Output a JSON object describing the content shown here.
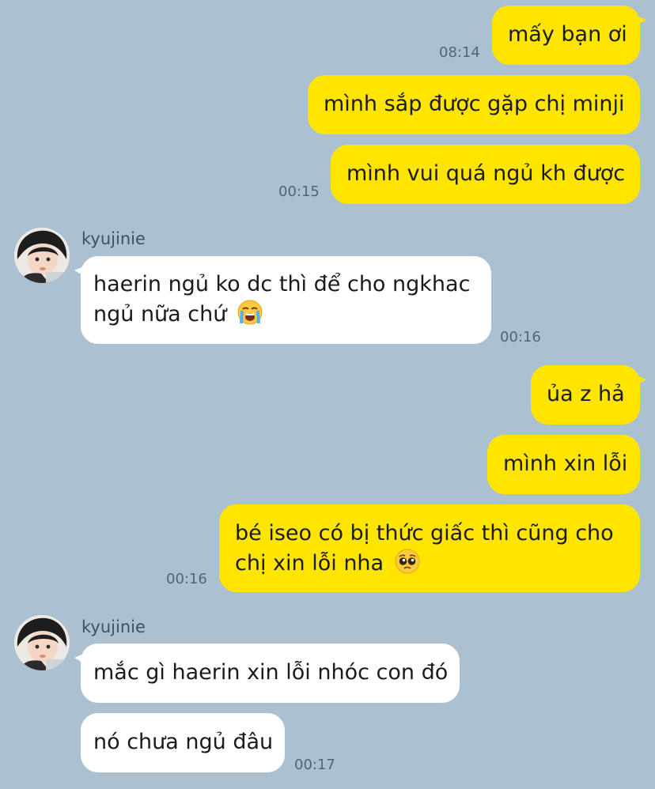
{
  "chat": {
    "messages": [
      {
        "text": "mấy bạn ơi",
        "time": "08:14"
      },
      {
        "text": "mình sắp được gặp chị minji"
      },
      {
        "text": "mình vui quá ngủ kh được",
        "time": "00:15"
      },
      {
        "sender": "kyujinie",
        "line1": "haerin ngủ ko dc thì để cho ngkhac",
        "line2": "ngủ nữa chứ",
        "emoji": "loudly-crying-face",
        "time": "00:16"
      },
      {
        "text": "ủa z hả"
      },
      {
        "text": "mình xin lỗi"
      },
      {
        "line1": "bé iseo có bị thức giấc thì cũng cho",
        "line2": "chị xin lỗi nha",
        "emoji": "pleading-face",
        "time": "00:16"
      },
      {
        "sender": "kyujinie",
        "text": "mắc gì haerin xin lỗi nhóc con đó"
      },
      {
        "text": "nó chưa ngủ đâu",
        "time": "00:17"
      }
    ]
  },
  "colors": {
    "background": "#abc1d1",
    "my_bubble": "#fee500",
    "their_bubble": "#ffffff",
    "timestamp": "#556472"
  }
}
